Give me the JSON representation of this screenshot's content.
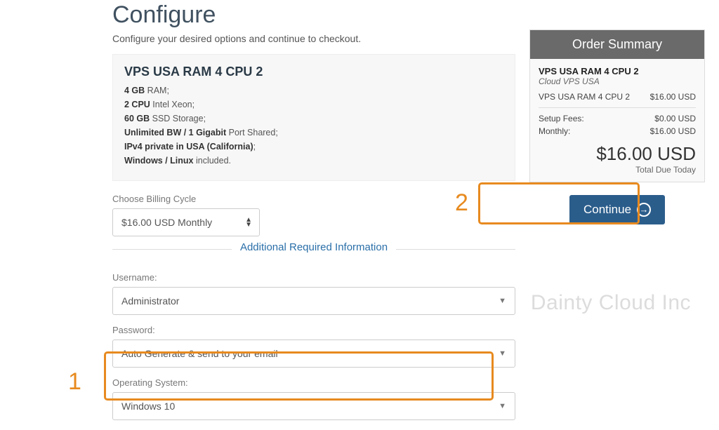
{
  "page": {
    "title": "Configure",
    "subtitle": "Configure your desired options and continue to checkout."
  },
  "product": {
    "name": "VPS USA RAM 4 CPU 2",
    "specs": {
      "ram_bold": "4 GB",
      "ram_rest": " RAM;",
      "cpu_bold": "2 CPU",
      "cpu_rest": " Intel Xeon;",
      "disk_bold": "60 GB",
      "disk_rest": " SSD Storage;",
      "bw_bold": "Unlimited BW / 1 Gigabit",
      "bw_rest": " Port Shared;",
      "ip_bold": "IPv4 private in USA (California)",
      "ip_rest": ";",
      "os_bold": "Windows / Linux",
      "os_rest": " included."
    }
  },
  "billing": {
    "label": "Choose Billing Cycle",
    "value": "$16.00 USD Monthly"
  },
  "section_title": "Additional Required Information",
  "fields": {
    "username": {
      "label": "Username:",
      "value": "Administrator"
    },
    "password": {
      "label": "Password:",
      "value": "Auto Generate & send to your email"
    },
    "os": {
      "label": "Operating System:",
      "value": "Windows 10"
    }
  },
  "summary": {
    "header": "Order Summary",
    "product_title": "VPS USA RAM 4 CPU 2",
    "product_sub": "Cloud VPS USA",
    "line1_label": "VPS USA RAM 4 CPU 2",
    "line1_value": "$16.00 USD",
    "setup_label": "Setup Fees:",
    "setup_value": "$0.00 USD",
    "monthly_label": "Monthly:",
    "monthly_value": "$16.00 USD",
    "total_amount": "$16.00 USD",
    "total_label": "Total Due Today"
  },
  "continue_label": "Continue",
  "watermark": "Dainty Cloud Inc",
  "annotations": {
    "one": "1",
    "two": "2"
  }
}
